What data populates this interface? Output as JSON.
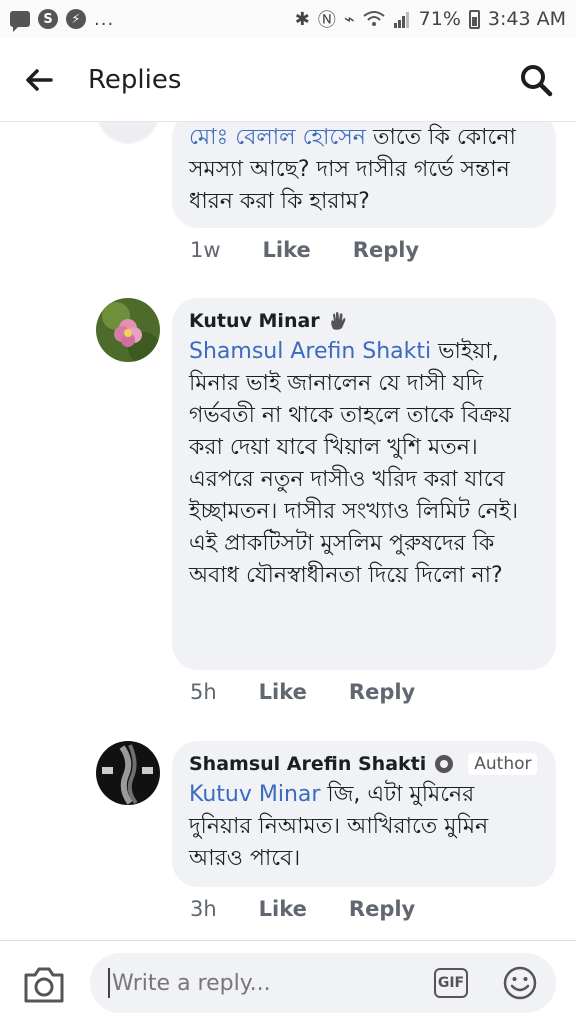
{
  "status_bar": {
    "battery": "71%",
    "time": "3:43 AM",
    "dots": "...",
    "icons": [
      "message-icon",
      "skype-icon",
      "messenger-icon",
      "bluetooth-icon",
      "nfc-icon",
      "vibrate-icon",
      "wifi-icon",
      "signal-icon",
      "battery-icon"
    ]
  },
  "header": {
    "title": "Replies",
    "back_icon": "arrow-left-icon",
    "search_icon": "search-icon"
  },
  "comments": [
    {
      "author": "",
      "badge": "",
      "mention": "মোঃ বেলাল হোসেন",
      "text": " তাতে কি কোনো সমস্যা আছে? দাস দাসীর গর্ভে সন্তান ধারন করা কি হারাম?",
      "time": "1w",
      "like": "Like",
      "reply": "Reply"
    },
    {
      "author": "Kutuv Minar",
      "badge": "",
      "author_icon": "wave-hand-icon",
      "mention": "Shamsul Arefin Shakti",
      "text": " ভাইয়া, মিনার ভাই জানালেন যে দাসী যদি গর্ভবতী না থাকে তাহলে তাকে বিক্রয় করা দেয়া যাবে খিয়াল খুশি মতন। এরপরে নতুন দাসীও খরিদ করা যাবে ইচ্ছামতন। দাসীর সংখ্যাও লিমিট নেই। এই প্রাকটিসটা মুসলিম পুরুষদের কি অবাধ যৌনস্বাধীনতা দিয়ে দিলো না?",
      "time": "5h",
      "like": "Like",
      "reply": "Reply"
    },
    {
      "author": "Shamsul Arefin Shakti",
      "badge": "Author",
      "author_icon": "verified-gear-icon",
      "mention": "Kutuv Minar",
      "text": " জি, এটা মুমিনের দুনিয়ার নিআমত। আখিরাতে মুমিন আরও পাবে।",
      "time": "3h",
      "like": "Like",
      "reply": "Reply"
    }
  ],
  "composer": {
    "placeholder": "Write a reply...",
    "gif_label": "GIF",
    "camera_icon": "camera-icon",
    "emoji_icon": "emoji-icon"
  },
  "colors": {
    "mention": "#3b6bbf",
    "bubble": "#f0f2f5",
    "meta_text": "#606770"
  }
}
